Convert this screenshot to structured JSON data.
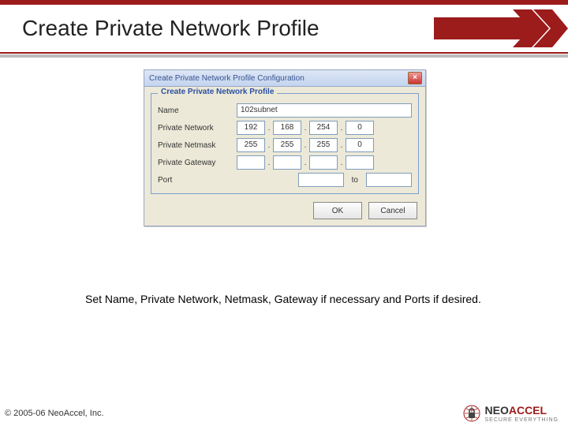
{
  "slide": {
    "title": "Create Private Network Profile",
    "caption": "Set Name, Private Network, Netmask, Gateway if necessary and Ports if desired."
  },
  "dialog": {
    "window_title": "Create Private Network Profile Configuration",
    "group_legend": "Create Private Network Profile",
    "labels": {
      "name": "Name",
      "private_network": "Private Network",
      "private_netmask": "Private Netmask",
      "private_gateway": "Private Gateway",
      "port": "Port"
    },
    "values": {
      "name": "102subnet",
      "private_network": [
        "192",
        "168",
        "254",
        "0"
      ],
      "private_netmask": [
        "255",
        "255",
        "255",
        "0"
      ],
      "private_gateway": [
        "",
        "",
        "",
        ""
      ],
      "port_from": "",
      "port_to_label": "to",
      "port_to": ""
    },
    "buttons": {
      "ok": "OK",
      "cancel": "Cancel"
    }
  },
  "footer": {
    "copyright": "© 2005-06 NeoAccel, Inc.",
    "logo": {
      "neo": "NEO",
      "accel": "ACCEL",
      "tag": "SECURE EVERYTHING"
    }
  }
}
